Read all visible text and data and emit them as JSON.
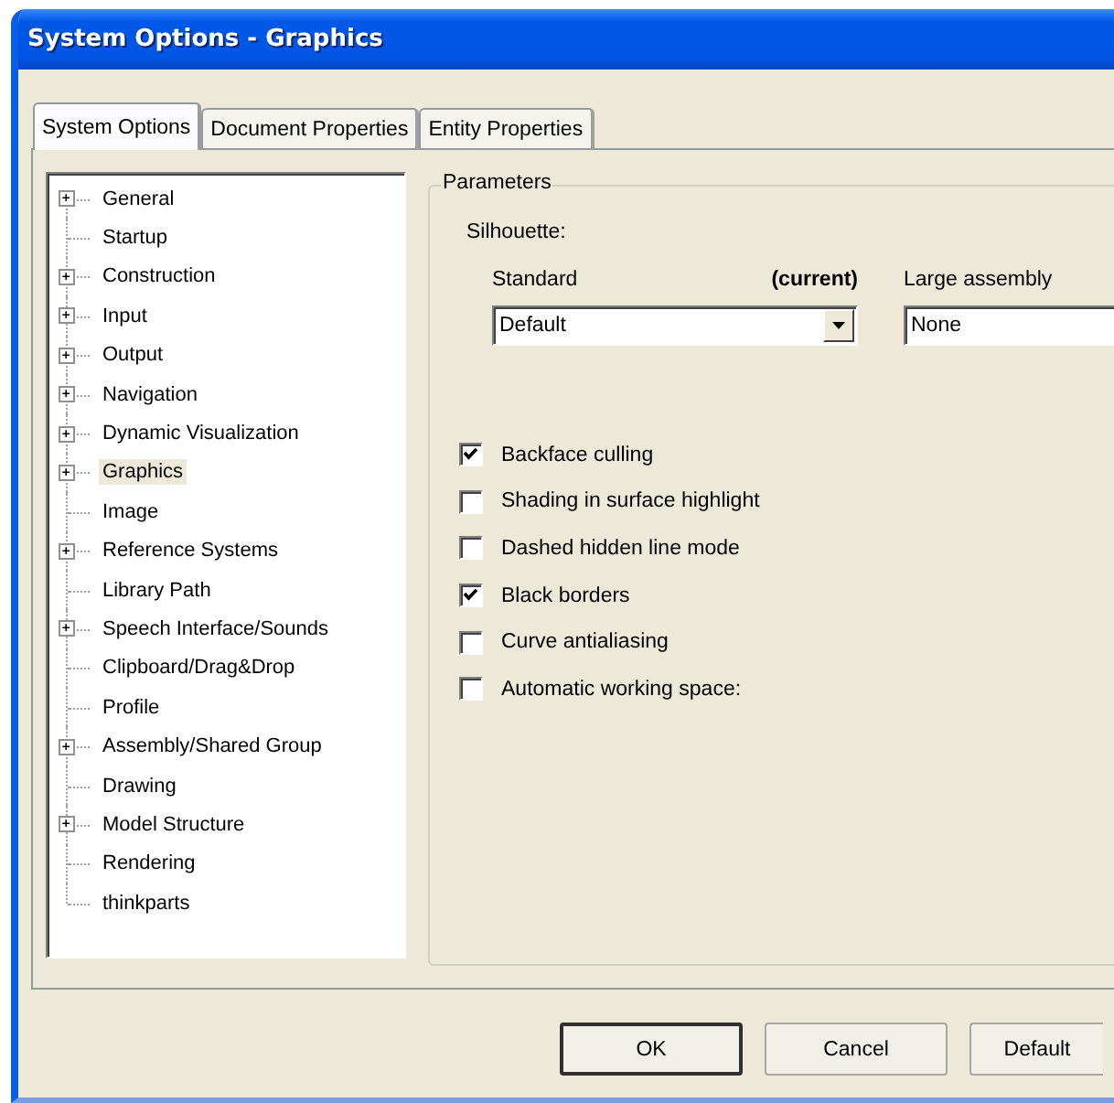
{
  "window": {
    "title": "System Options - Graphics"
  },
  "tabs": [
    {
      "label": "System Options",
      "selected": true
    },
    {
      "label": "Document Properties",
      "selected": false
    },
    {
      "label": "Entity Properties",
      "selected": false
    }
  ],
  "tree": {
    "items": [
      {
        "label": "General",
        "expandable": true,
        "selected": false
      },
      {
        "label": "Startup",
        "expandable": false,
        "selected": false
      },
      {
        "label": "Construction",
        "expandable": true,
        "selected": false
      },
      {
        "label": "Input",
        "expandable": true,
        "selected": false
      },
      {
        "label": "Output",
        "expandable": true,
        "selected": false
      },
      {
        "label": "Navigation",
        "expandable": true,
        "selected": false
      },
      {
        "label": "Dynamic Visualization",
        "expandable": true,
        "selected": false
      },
      {
        "label": "Graphics",
        "expandable": true,
        "selected": true
      },
      {
        "label": "Image",
        "expandable": false,
        "selected": false
      },
      {
        "label": "Reference Systems",
        "expandable": true,
        "selected": false
      },
      {
        "label": "Library Path",
        "expandable": false,
        "selected": false
      },
      {
        "label": "Speech Interface/Sounds",
        "expandable": true,
        "selected": false
      },
      {
        "label": "Clipboard/Drag&Drop",
        "expandable": false,
        "selected": false
      },
      {
        "label": "Profile",
        "expandable": false,
        "selected": false
      },
      {
        "label": "Assembly/Shared Group",
        "expandable": true,
        "selected": false
      },
      {
        "label": "Drawing",
        "expandable": false,
        "selected": false
      },
      {
        "label": "Model Structure",
        "expandable": true,
        "selected": false
      },
      {
        "label": "Rendering",
        "expandable": false,
        "selected": false
      },
      {
        "label": "thinkparts",
        "expandable": false,
        "selected": false
      }
    ]
  },
  "parameters": {
    "title": "Parameters",
    "silhouette_label": "Silhouette:",
    "standard": {
      "label": "Standard",
      "note": "(current)",
      "value": "Default"
    },
    "large_assembly": {
      "label": "Large assembly",
      "value": "None"
    },
    "checkboxes": [
      {
        "label": "Backface culling",
        "checked": true
      },
      {
        "label": "Shading in surface highlight",
        "checked": false
      },
      {
        "label": "Dashed hidden line mode",
        "checked": false
      },
      {
        "label": "Black borders",
        "checked": true
      },
      {
        "label": "Curve antialiasing",
        "checked": false
      },
      {
        "label": "Automatic working space:",
        "checked": false
      }
    ]
  },
  "buttons": [
    {
      "label": "OK",
      "default": true
    },
    {
      "label": "Cancel",
      "default": false
    },
    {
      "label": "Default",
      "default": false
    }
  ]
}
